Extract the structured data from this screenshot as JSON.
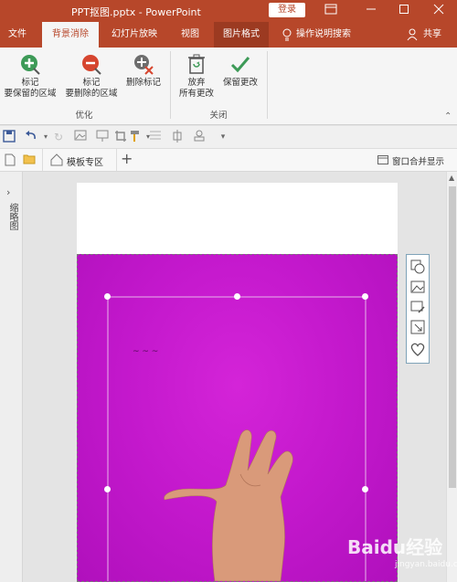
{
  "titlebar": {
    "title": "PPT抠图.pptx  -  PowerPoint",
    "login_label": "登录"
  },
  "tabs": [
    {
      "label": "文件"
    },
    {
      "label": "背景消除"
    },
    {
      "label": "幻灯片放映"
    },
    {
      "label": "视图"
    },
    {
      "label": "图片格式"
    }
  ],
  "tell_me": "操作说明搜索",
  "share": "共享",
  "ribbon": {
    "mark_keep_line1": "标记",
    "mark_keep_line2": "要保留的区域",
    "mark_remove_line1": "标记",
    "mark_remove_line2": "要删除的区域",
    "delete_mark": "删除标记",
    "group_refine": "优化",
    "discard_line1": "放弃",
    "discard_line2": "所有更改",
    "keep_changes": "保留更改",
    "group_close": "关闭"
  },
  "filebar": {
    "template_tab": "模板专区",
    "merge_windows": "窗口合并显示"
  },
  "sidebar": {
    "label": "缩略图"
  },
  "watermark": {
    "brand": "Baidu经验",
    "url": "jingyan.baidu.com"
  },
  "colors": {
    "accent": "#b7472a",
    "photo_magenta": "#c318cc"
  }
}
